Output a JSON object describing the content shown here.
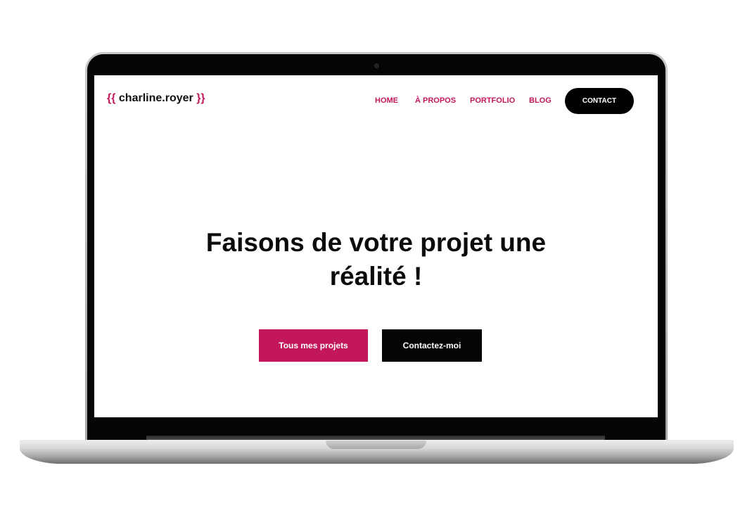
{
  "site": {
    "logo": {
      "open_brace": "{{",
      "name": "charline.royer",
      "close_brace": "}}"
    },
    "nav": {
      "home": "HOME",
      "apropos": "À PROPOS",
      "portfolio": "PORTFOLIO",
      "blog": "BLOG",
      "contact": "CONTACT"
    },
    "hero": {
      "title_line1": "Faisons de votre projet une",
      "title_line2": "réalité !",
      "primary_button": "Tous mes projets",
      "secondary_button": "Contactez-moi"
    }
  },
  "colors": {
    "accent": "#c2185b",
    "dark": "#000000",
    "background": "#ffffff"
  }
}
